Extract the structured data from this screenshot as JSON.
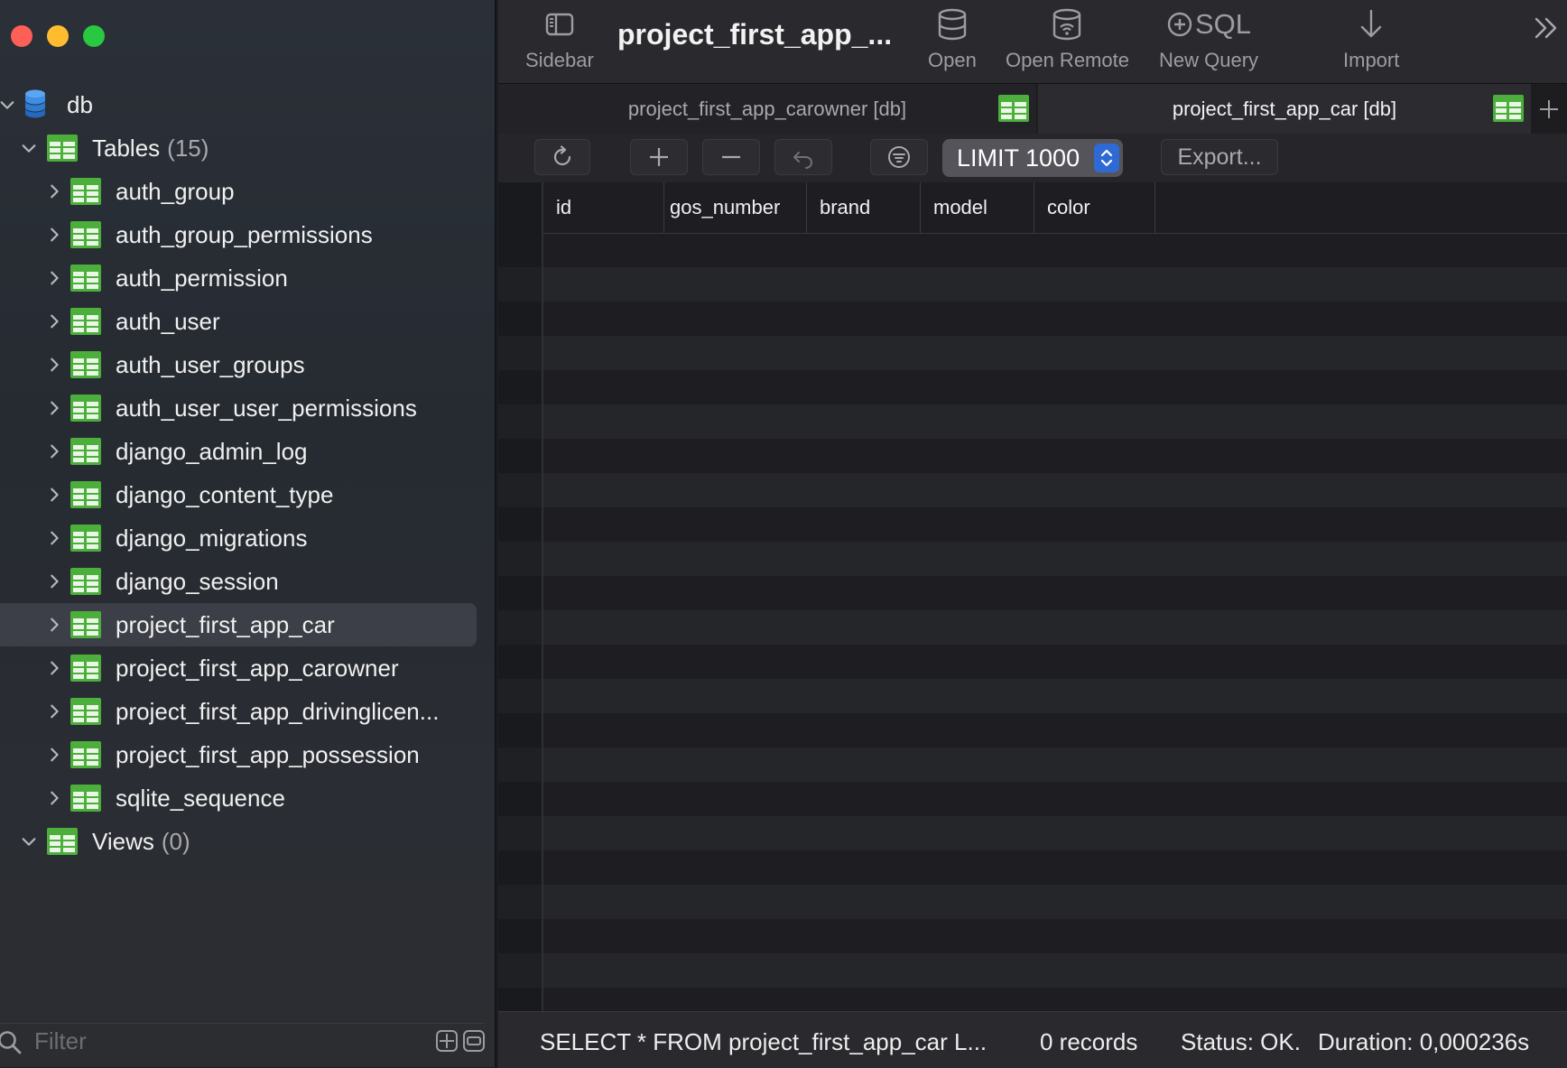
{
  "sidebar": {
    "database": "db",
    "tables_label": "Tables",
    "tables_count": "(15)",
    "tables": [
      "auth_group",
      "auth_group_permissions",
      "auth_permission",
      "auth_user",
      "auth_user_groups",
      "auth_user_user_permissions",
      "django_admin_log",
      "django_content_type",
      "django_migrations",
      "django_session",
      "project_first_app_car",
      "project_first_app_carowner",
      "project_first_app_drivinglicen...",
      "project_first_app_possession",
      "sqlite_sequence"
    ],
    "selected_table": "project_first_app_car",
    "views_label": "Views",
    "views_count": "(0)",
    "filter_placeholder": "Filter"
  },
  "toolbar": {
    "sidebar_label": "Sidebar",
    "window_title": "project_first_app_...",
    "open_label": "Open",
    "open_remote_label": "Open Remote",
    "new_query_label": "New Query",
    "new_query_icon_text": "SQL",
    "import_label": "Import"
  },
  "tabs": [
    {
      "label": "project_first_app_carowner [db]",
      "active": false
    },
    {
      "label": "project_first_app_car [db]",
      "active": true
    }
  ],
  "actions": {
    "limit_label": "LIMIT 1000",
    "export_label": "Export..."
  },
  "columns": [
    "id",
    "gos_number",
    "brand",
    "model",
    "color"
  ],
  "status": {
    "query": "SELECT * FROM project_first_app_car L...",
    "records": "0 records",
    "status_text": "Status: OK.",
    "duration": "Duration: 0,000236s"
  },
  "colors": {
    "accent": "#2f6ad4",
    "table_icon": "#4caf3c",
    "db_icon": "#3d8ee8"
  }
}
